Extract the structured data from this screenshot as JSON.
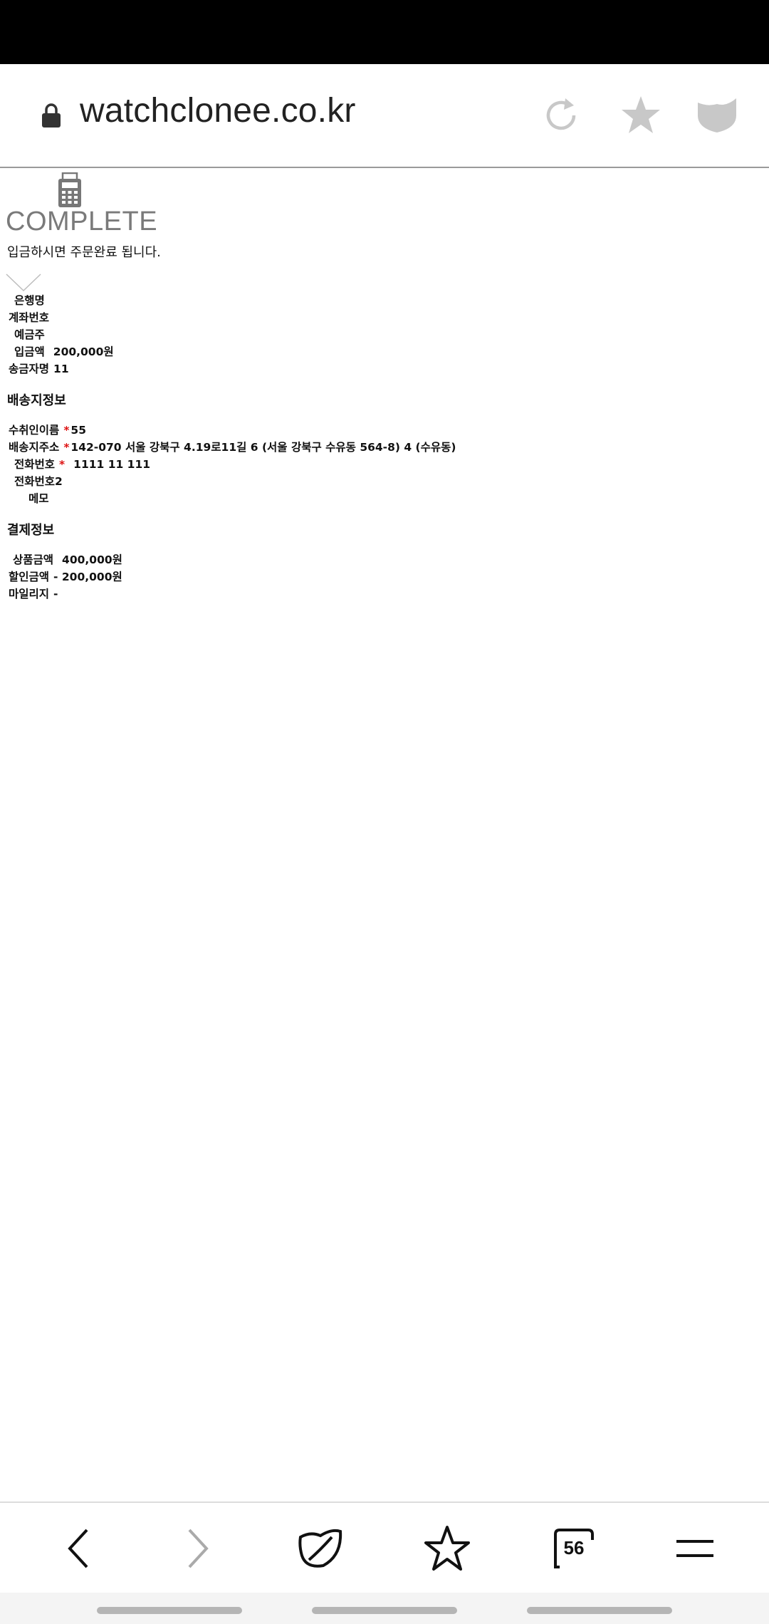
{
  "browser": {
    "url": "watchclonee.co.kr",
    "tab_count": "56"
  },
  "page": {
    "title": "COMPLETE",
    "notice": "입금하시면 주문완료 됩니다."
  },
  "payment_info": {
    "bank_label": "은행명",
    "bank_value": "",
    "account_label": "계좌번호",
    "account_value": "",
    "holder_label": "예금주",
    "holder_value": "",
    "amount_label": "입금액",
    "amount_value": "200,000원",
    "sender_label": "송금자명",
    "sender_value": "11"
  },
  "shipping": {
    "title": "배송지정보",
    "required_mark": "*",
    "recipient_label": "수취인이름",
    "recipient_value": "55",
    "address_label": "배송지주소",
    "address_value": "142-070 서울 강북구 4.19로11길 6 (서울 강북구 수유동 564-8) 4 (수유동)",
    "phone_label": "전화번호",
    "phone_value": "1111 11 111",
    "phone2_label": "전화번호2",
    "phone2_value": "",
    "memo_label": "메모",
    "memo_value": ""
  },
  "billing": {
    "title": "결제정보",
    "product_amount_label": "상품금액",
    "product_amount_value": "400,000원",
    "discount_label": "할인금액",
    "discount_value": "- 200,000원",
    "mileage_label": "마일리지",
    "mileage_value": "-"
  },
  "colors": {
    "status_bar": "#000000",
    "title_gray": "#7a7a7a",
    "required_red": "#dd1111",
    "icon_gray": "#c8c8c8"
  }
}
